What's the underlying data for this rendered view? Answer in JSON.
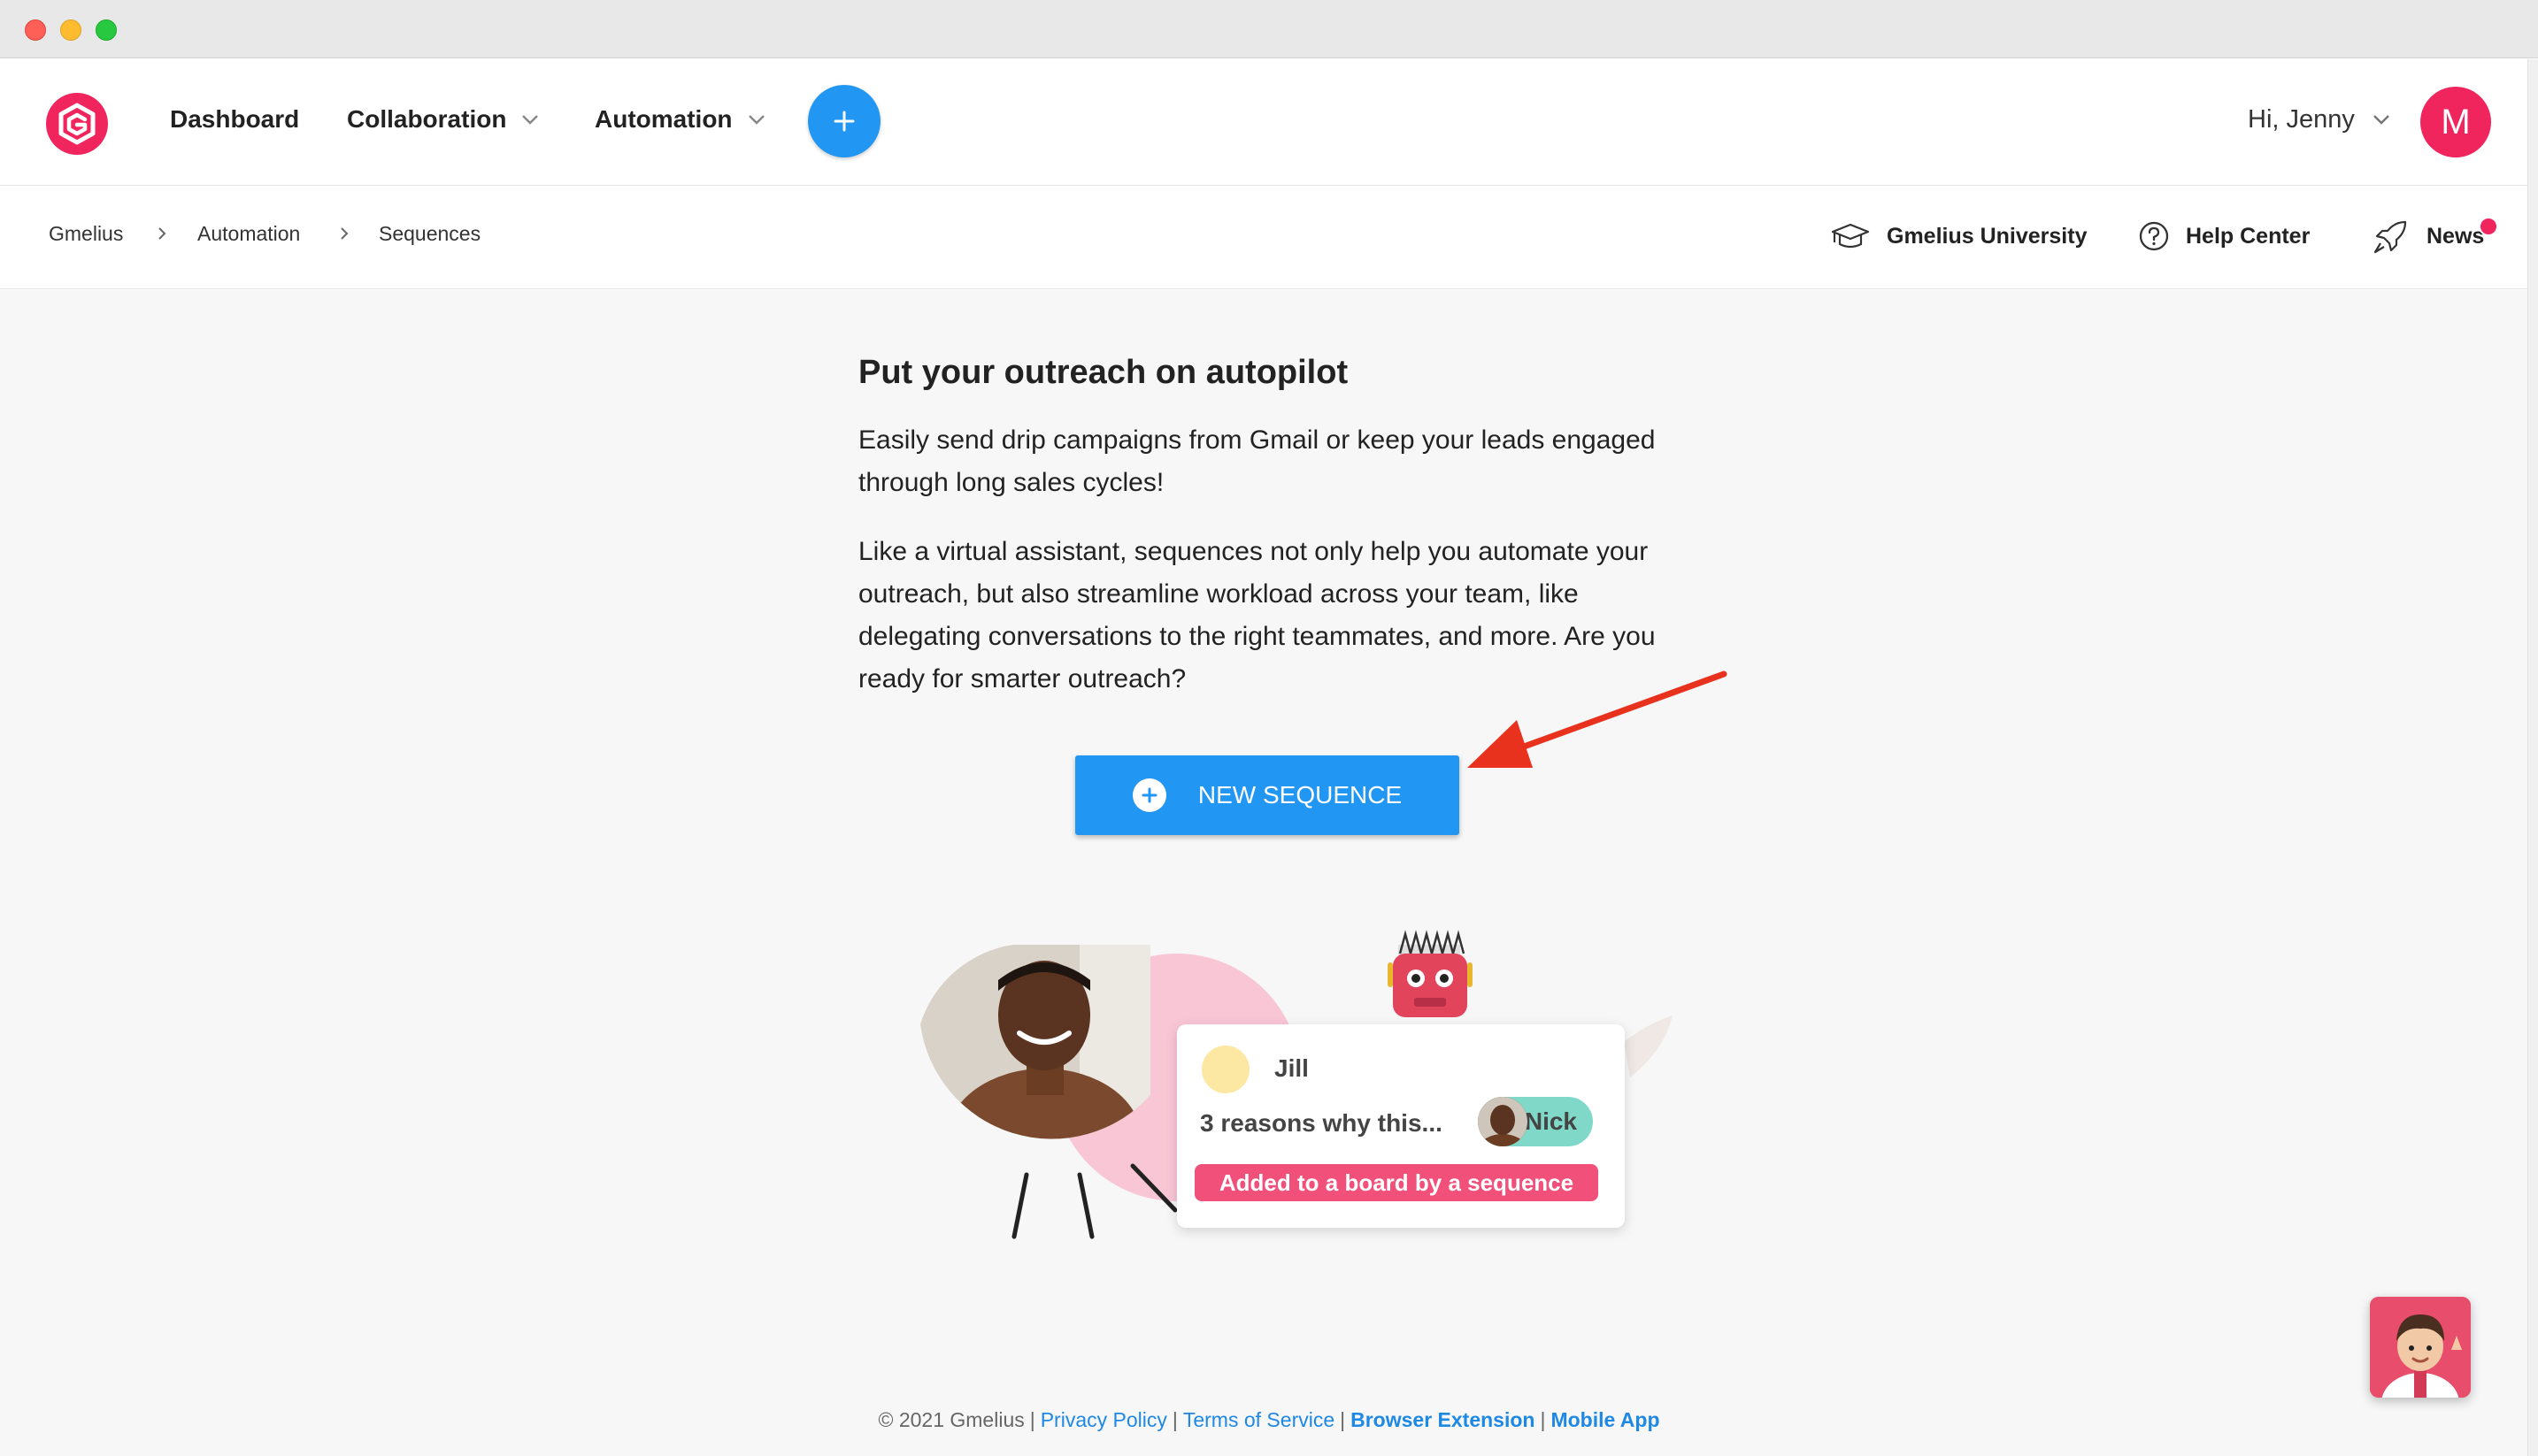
{
  "nav": {
    "items": [
      {
        "label": "Dashboard"
      },
      {
        "label": "Collaboration"
      },
      {
        "label": "Automation"
      }
    ],
    "greeting": "Hi, Jenny",
    "avatar_initial": "M"
  },
  "breadcrumb": [
    "Gmelius",
    "Automation",
    "Sequences"
  ],
  "utilities": {
    "university": "Gmelius University",
    "help": "Help Center",
    "news": "News"
  },
  "main": {
    "heading": "Put your outreach on autopilot",
    "para1": "Easily send drip campaigns from Gmail or keep your leads engaged through long sales cycles!",
    "para2": "Like a virtual assistant, sequences not only help you automate your outreach, but also streamline workload across your team, like delegating conversations to the right teammates, and more. Are you ready for smarter outreach?",
    "new_sequence_label": "NEW SEQUENCE"
  },
  "illustration": {
    "card_name": "Jill",
    "card_subject": "3 reasons why this...",
    "assignee": "Nick",
    "tag": "Added to a board by a sequence"
  },
  "footer": {
    "copyright": "© 2021 Gmelius",
    "links": [
      "Privacy Policy",
      "Terms of Service",
      "Browser Extension",
      "Mobile App"
    ]
  },
  "colors": {
    "brand_red": "#f0255d",
    "primary_blue": "#2196f3",
    "link_blue": "#1e88e5",
    "annotation_arrow": "#e8321e"
  }
}
